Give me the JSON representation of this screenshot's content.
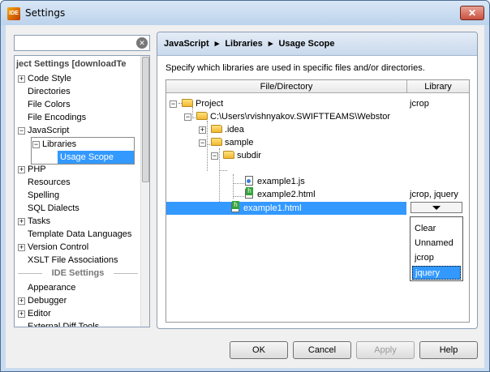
{
  "window": {
    "title": "Settings"
  },
  "search": {
    "value": "",
    "placeholder": ""
  },
  "left_tree": {
    "project_header": "ject Settings [downloadTe",
    "items": [
      {
        "label": "Code Style",
        "expander": "+"
      },
      {
        "label": "Directories",
        "expander": ""
      },
      {
        "label": "File Colors",
        "expander": ""
      },
      {
        "label": "File Encodings",
        "expander": ""
      },
      {
        "label": "JavaScript",
        "expander": "−"
      },
      {
        "label": "Libraries",
        "expander": "−"
      },
      {
        "label": "Usage Scope",
        "expander": ""
      },
      {
        "label": "PHP",
        "expander": "+"
      },
      {
        "label": "Resources",
        "expander": ""
      },
      {
        "label": "Spelling",
        "expander": ""
      },
      {
        "label": "SQL Dialects",
        "expander": ""
      },
      {
        "label": "Tasks",
        "expander": "+"
      },
      {
        "label": "Template Data Languages",
        "expander": ""
      },
      {
        "label": "Version Control",
        "expander": "+"
      },
      {
        "label": "XSLT File Associations",
        "expander": ""
      }
    ],
    "ide_header": "IDE Settings",
    "ide_items": [
      {
        "label": "Appearance",
        "expander": ""
      },
      {
        "label": "Debugger",
        "expander": "+"
      },
      {
        "label": "Editor",
        "expander": "+"
      },
      {
        "label": "External Diff Tools",
        "expander": ""
      }
    ]
  },
  "breadcrumb": {
    "part1": "JavaScript",
    "sep": "▸",
    "part2": "Libraries",
    "part3": "Usage Scope"
  },
  "description": "Specify which libraries are used in specific files and/or directories.",
  "grid": {
    "col_file": "File/Directory",
    "col_library": "Library",
    "rows": [
      {
        "label": "Project",
        "library": "jcrop"
      },
      {
        "label": "C:\\Users\\rvishnyakov.SWIFTTEAMS\\Webstor",
        "library": ""
      },
      {
        "label": ".idea",
        "library": ""
      },
      {
        "label": "sample",
        "library": ""
      },
      {
        "label": "subdir",
        "library": ""
      },
      {
        "label": "example1.js",
        "library": ""
      },
      {
        "label": "example2.html",
        "library": "jcrop, jquery"
      },
      {
        "label": "example1.html",
        "library": ""
      }
    ]
  },
  "dropdown": {
    "options": [
      "Clear",
      "Unnamed",
      "jcrop",
      "jquery"
    ],
    "selected": "jquery"
  },
  "buttons": {
    "ok": "OK",
    "cancel": "Cancel",
    "apply": "Apply",
    "help": "Help"
  },
  "colors": {
    "selection": "#3399ff",
    "frame": "#c9dbef"
  }
}
